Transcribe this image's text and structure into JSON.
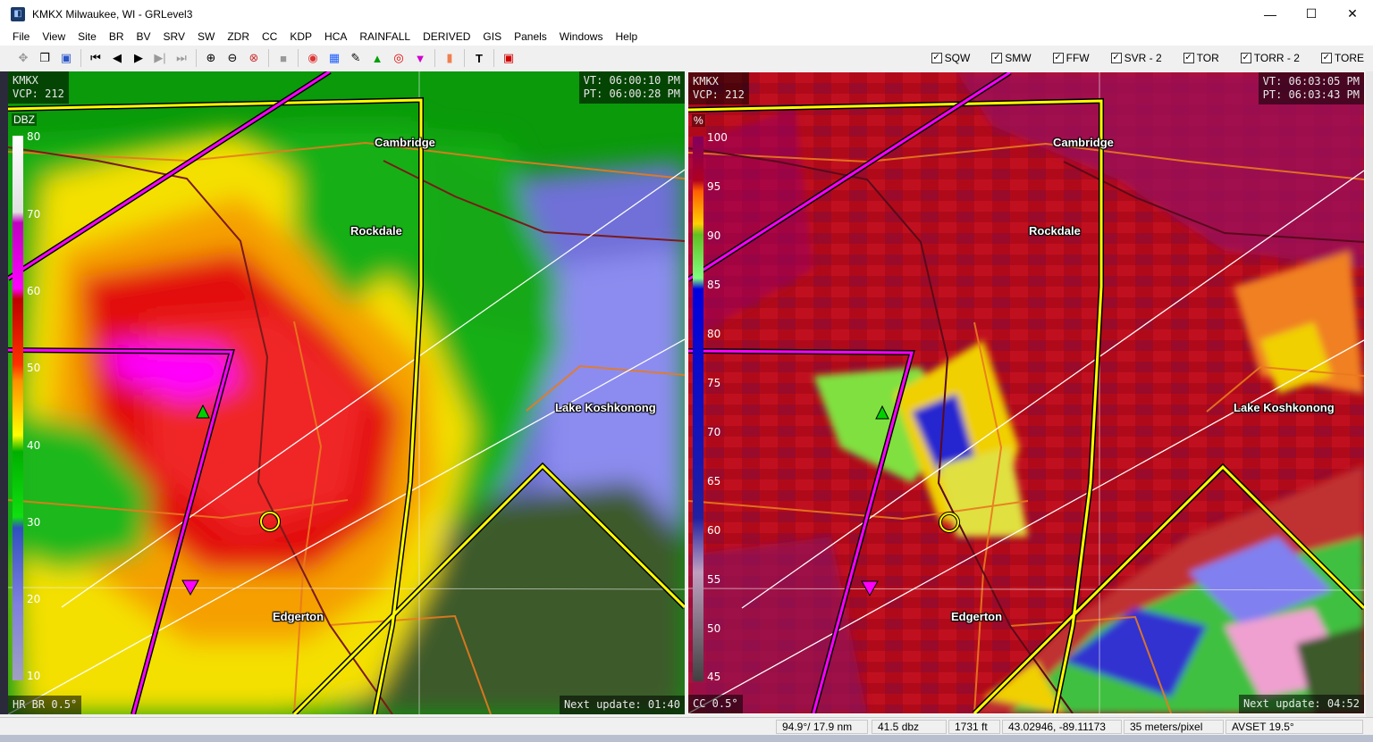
{
  "window": {
    "title": "KMKX Milwaukee, WI - GRLevel3",
    "minimize": "—",
    "maximize": "☐",
    "close": "✕"
  },
  "menu": [
    "File",
    "View",
    "Site",
    "BR",
    "BV",
    "SRV",
    "SW",
    "ZDR",
    "CC",
    "KDP",
    "HCA",
    "RAINFALL",
    "DERIVED",
    "GIS",
    "Panels",
    "Windows",
    "Help"
  ],
  "warnings": [
    {
      "label": "SQW",
      "checked": true
    },
    {
      "label": "SMW",
      "checked": true
    },
    {
      "label": "FFW",
      "checked": true
    },
    {
      "label": "SVR - 2",
      "checked": true
    },
    {
      "label": "TOR",
      "checked": true
    },
    {
      "label": "TORR - 2",
      "checked": true
    },
    {
      "label": "TORE",
      "checked": true
    }
  ],
  "left_panel": {
    "site": "KMKX",
    "vcp": "VCP: 212",
    "vt": "VT: 06:00:10 PM",
    "pt": "PT: 06:00:28 PM",
    "product": "HR BR 0.5°",
    "next_update": "Next update: 01:40",
    "unit": "DBZ",
    "scale": [
      "80",
      "70",
      "60",
      "50",
      "40",
      "30",
      "20",
      "10"
    ]
  },
  "right_panel": {
    "site": "KMKX",
    "vcp": "VCP: 212",
    "vt": "VT: 06:03:05 PM",
    "pt": "PT: 06:03:43 PM",
    "product": "CC 0.5°",
    "next_update": "Next update: 04:52",
    "unit": "%",
    "scale": [
      "100",
      "95",
      "90",
      "85",
      "80",
      "75",
      "70",
      "65",
      "60",
      "55",
      "50",
      "45"
    ]
  },
  "towns": [
    "Cambridge",
    "Rockdale",
    "Lake Koshkonong",
    "Edgerton"
  ],
  "status": {
    "azimuth_range": "94.9°/ 17.9 nm",
    "value": "41.5 dbz",
    "height": "1731 ft",
    "coords": "43.02946, -89.11173",
    "resolution": "35 meters/pixel",
    "avset": "AVSET 19.5°"
  },
  "colors": {
    "tornado_warning": "#ff00ff",
    "svr_warning": "#ffff00",
    "road": "#e87a1e"
  }
}
